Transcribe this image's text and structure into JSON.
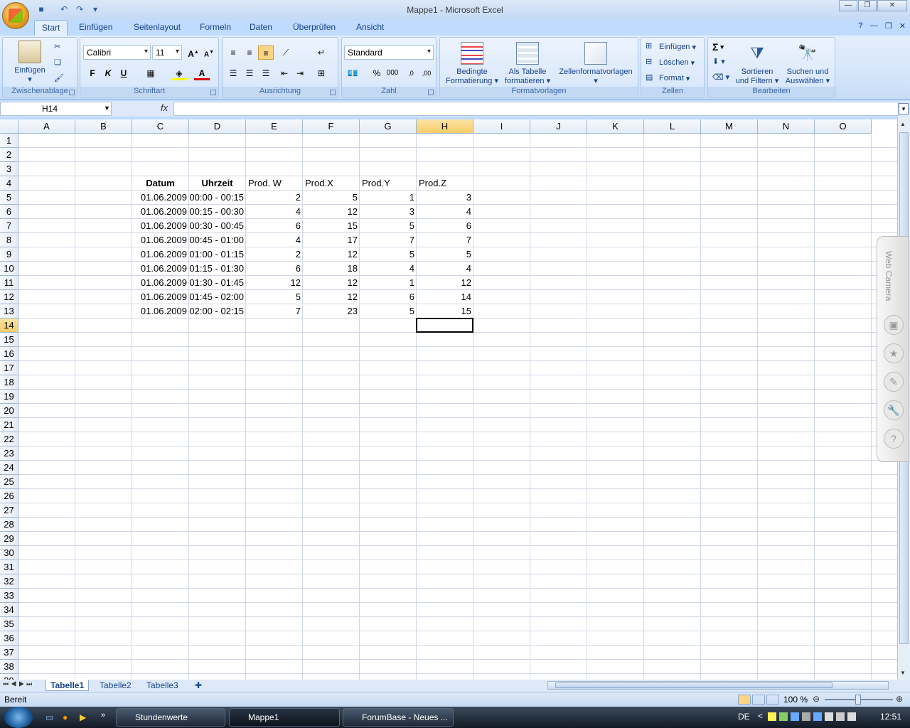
{
  "window": {
    "title": "Mappe1 - Microsoft Excel"
  },
  "tabs": [
    "Start",
    "Einfügen",
    "Seitenlayout",
    "Formeln",
    "Daten",
    "Überprüfen",
    "Ansicht"
  ],
  "ribbon": {
    "clipboard": {
      "paste": "Einfügen",
      "label": "Zwischenablage"
    },
    "font": {
      "name": "Calibri",
      "size": "11",
      "bold": "F",
      "italic": "K",
      "underline": "U",
      "label": "Schriftart"
    },
    "alignment": {
      "label": "Ausrichtung"
    },
    "number": {
      "format": "Standard",
      "percent": "%",
      "thousands": "000",
      "label": "Zahl"
    },
    "styles": {
      "conditional": "Bedingte",
      "conditional2": "Formatierung",
      "table": "Als Tabelle",
      "table2": "formatieren",
      "cellstyles": "Zellenformatvorlagen",
      "label": "Formatvorlagen"
    },
    "cells": {
      "insert": "Einfügen",
      "delete": "Löschen",
      "format": "Format",
      "label": "Zellen"
    },
    "editing": {
      "sigma": "Σ",
      "sort": "Sortieren",
      "sort2": "und Filtern",
      "find": "Suchen und",
      "find2": "Auswählen",
      "label": "Bearbeiten"
    }
  },
  "formula_bar": {
    "name_box": "H14",
    "fx": "fx",
    "value": ""
  },
  "columns": [
    "A",
    "B",
    "C",
    "D",
    "E",
    "F",
    "G",
    "H",
    "I",
    "J",
    "K",
    "L",
    "M",
    "N",
    "O"
  ],
  "rows": [
    "1",
    "2",
    "3",
    "4",
    "5",
    "6",
    "7",
    "8",
    "9",
    "10",
    "11",
    "12",
    "13",
    "14",
    "15",
    "16",
    "17",
    "18",
    "19",
    "20",
    "21",
    "22",
    "23",
    "24",
    "25",
    "26",
    "27",
    "28",
    "29",
    "30",
    "31",
    "32",
    "33",
    "34",
    "35",
    "36",
    "37",
    "38",
    "39"
  ],
  "table": {
    "headers": {
      "date": "Datum",
      "time": "Uhrzeit",
      "w": "Prod. W",
      "x": "Prod.X",
      "y": "Prod.Y",
      "z": "Prod.Z"
    },
    "rows": [
      [
        "01.06.2009",
        "00:00 - 00:15",
        "2",
        "5",
        "1",
        "3"
      ],
      [
        "01.06.2009",
        "00:15 - 00:30",
        "4",
        "12",
        "3",
        "4"
      ],
      [
        "01.06.2009",
        "00:30 - 00:45",
        "6",
        "15",
        "5",
        "6"
      ],
      [
        "01.06.2009",
        "00:45 - 01:00",
        "4",
        "17",
        "7",
        "7"
      ],
      [
        "01.06.2009",
        "01:00 - 01:15",
        "2",
        "12",
        "5",
        "5"
      ],
      [
        "01.06.2009",
        "01:15 - 01:30",
        "6",
        "18",
        "4",
        "4"
      ],
      [
        "01.06.2009",
        "01:30 - 01:45",
        "12",
        "12",
        "1",
        "12"
      ],
      [
        "01.06.2009",
        "01:45 - 02:00",
        "5",
        "12",
        "6",
        "14"
      ],
      [
        "01.06.2009",
        "02:00 - 02:15",
        "7",
        "23",
        "5",
        "15"
      ]
    ]
  },
  "sheets": [
    "Tabelle1",
    "Tabelle2",
    "Tabelle3"
  ],
  "status": {
    "text": "Bereit",
    "zoom": "100 %"
  },
  "sidebar": {
    "label": "Web Camera"
  },
  "taskbar": {
    "items": [
      "Stundenwerte",
      "Mappe1",
      "ForumBase - Neues ..."
    ],
    "lang": "DE",
    "clock": "12:51"
  }
}
